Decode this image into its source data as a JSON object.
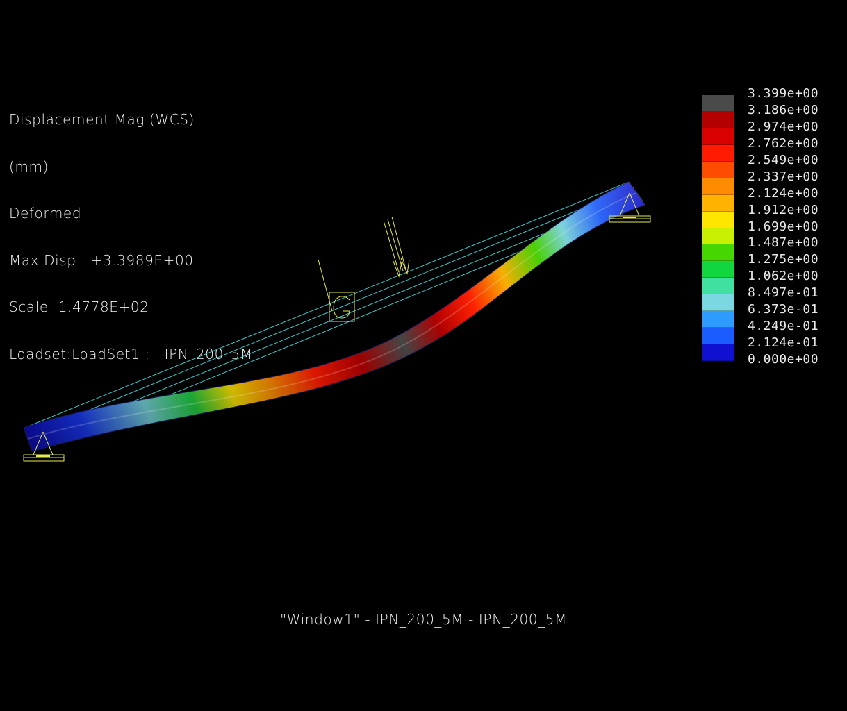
{
  "info": {
    "result_name": "Displacement Mag (WCS)",
    "units": "(mm)",
    "display_mode": "Deformed",
    "max_disp": "Max Disp   +3.3989E+00",
    "scale": "Scale  1.4778E+02",
    "loadset": "Loadset:LoadSet1 :   IPN_200_5M"
  },
  "legend": {
    "labels": [
      "3.399e+00",
      "3.186e+00",
      "2.974e+00",
      "2.762e+00",
      "2.549e+00",
      "2.337e+00",
      "2.124e+00",
      "1.912e+00",
      "1.699e+00",
      "1.487e+00",
      "1.275e+00",
      "1.062e+00",
      "8.497e-01",
      "6.373e-01",
      "4.249e-01",
      "2.124e-01",
      "0.000e+00"
    ],
    "colors": [
      "#4a4a4a",
      "#b30000",
      "#d90000",
      "#ff1a00",
      "#ff4d00",
      "#ff8c00",
      "#ffb300",
      "#ffe600",
      "#c8f000",
      "#46d600",
      "#12d640",
      "#3fe0a0",
      "#7ad8e0",
      "#2e9bff",
      "#1a5cff",
      "#1010d0"
    ]
  },
  "window_title": "\"Window1\" - IPN_200_5M - IPN_200_5M",
  "icons": {
    "support_left": "fixed-support-icon",
    "support_right": "fixed-support-icon",
    "load_arrow": "force-arrow-icon",
    "gravity": "gravity-icon"
  },
  "colors": {
    "background": "#000000",
    "wireframe": "#3fc8c8",
    "annotation": "#e8e850",
    "text": "#f0f0f0"
  }
}
